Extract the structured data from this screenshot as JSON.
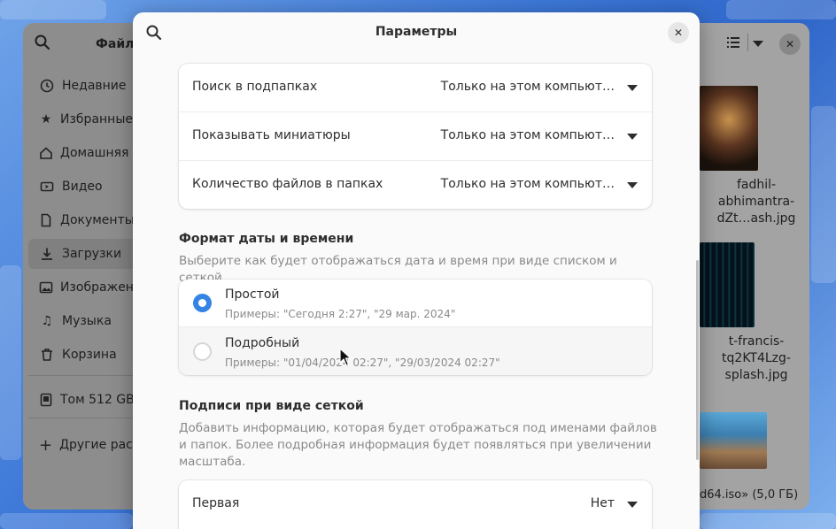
{
  "file_manager": {
    "title": "Файлы",
    "sidebar": [
      {
        "label": "Недавние",
        "icon": "clock-icon"
      },
      {
        "label": "Избранные",
        "icon": "star-icon"
      },
      {
        "label": "Домашняя папка",
        "icon": "home-icon"
      },
      {
        "label": "Видео",
        "icon": "video-icon"
      },
      {
        "label": "Документы",
        "icon": "document-icon"
      },
      {
        "label": "Загрузки",
        "icon": "download-icon"
      },
      {
        "label": "Изображения",
        "icon": "image-icon"
      },
      {
        "label": "Музыка",
        "icon": "music-icon"
      },
      {
        "label": "Корзина",
        "icon": "trash-icon"
      }
    ],
    "volume": {
      "label": "Том 512 GB",
      "icon": "drive-icon"
    },
    "other": {
      "label": "Другие расположения",
      "icon": "plus-icon"
    },
    "files": [
      {
        "name_lines": [
          "fadhil-",
          "abhimantra-",
          "dZt…ash.jpg"
        ]
      },
      {
        "name_lines": [
          "t-francis-",
          "tq2KT4Lzg-",
          "splash.jpg"
        ]
      }
    ],
    "status": "d64.iso» (5,0 ГБ)"
  },
  "dialog": {
    "title": "Параметры",
    "performance_rows": [
      {
        "label": "Поиск в подпапках",
        "value": "Только на этом компьют…"
      },
      {
        "label": "Показывать миниатюры",
        "value": "Только на этом компьют…"
      },
      {
        "label": "Количество файлов в папках",
        "value": "Только на этом компьют…"
      }
    ],
    "datetime": {
      "title": "Формат даты и времени",
      "description": "Выберите как будет отображаться дата и время при виде списком и сеткой.",
      "options": [
        {
          "label": "Простой",
          "example": "Примеры: \"Сегодня 2:27\", \"29 мар. 2024\"",
          "selected": true
        },
        {
          "label": "Подробный",
          "example": "Примеры: \"01/04/2024 02:27\", \"29/03/2024 02:27\"",
          "selected": false
        }
      ]
    },
    "grid_captions": {
      "title": "Подписи при виде сеткой",
      "description": "Добавить информацию, которая будет отображаться под именами файлов и папок. Более подробная информация будет появляться при увеличении масштаба.",
      "rows": [
        {
          "label": "Первая",
          "value": "Нет"
        }
      ]
    }
  },
  "colors": {
    "accent": "#3584e4"
  }
}
